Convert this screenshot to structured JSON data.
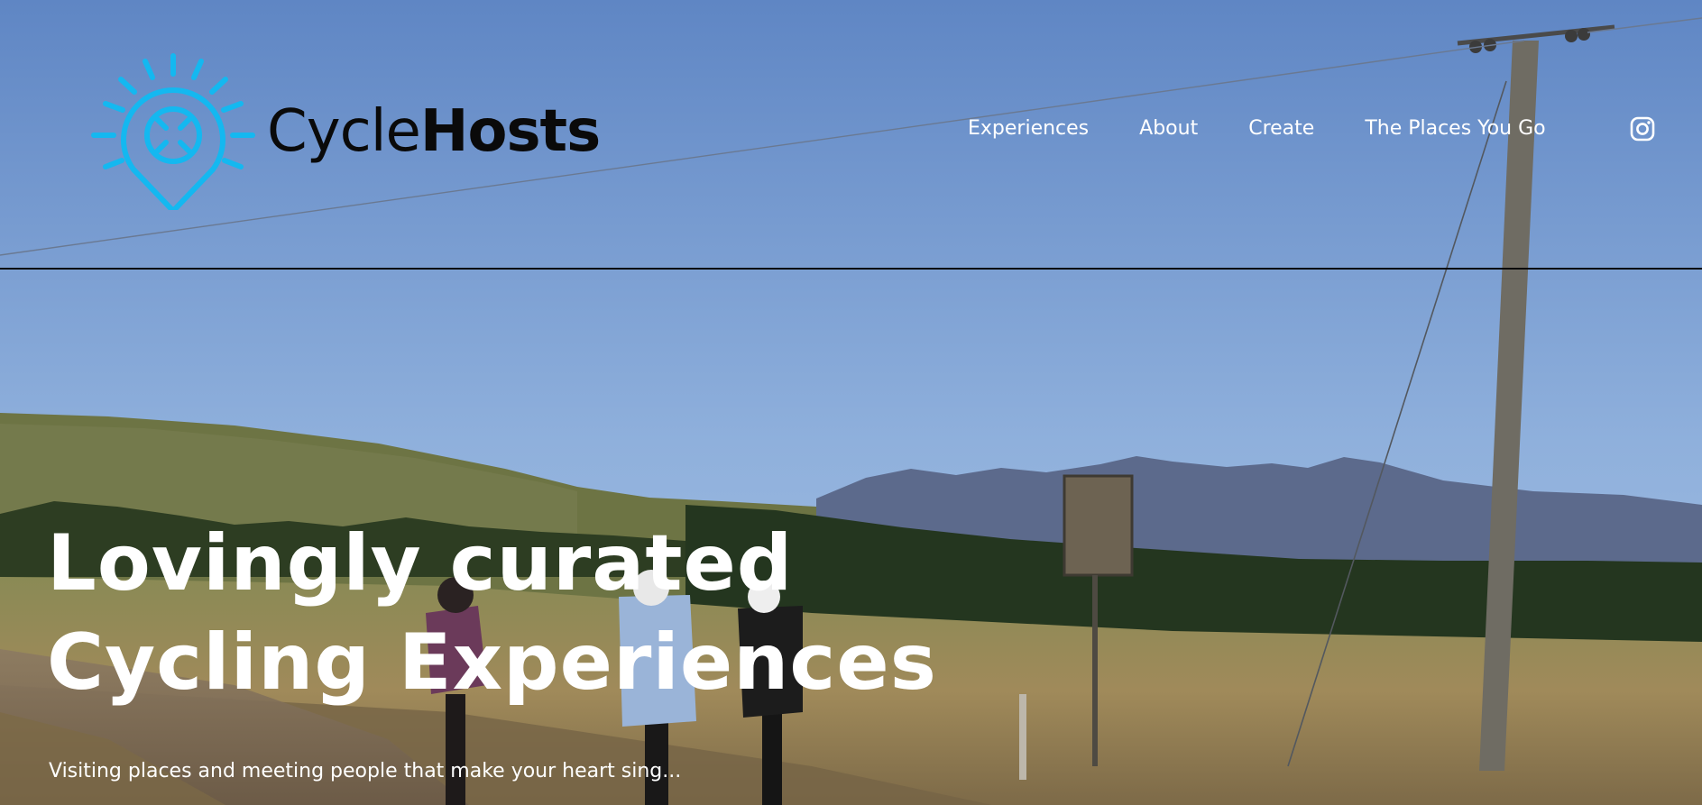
{
  "brand": {
    "name_light": "Cycle",
    "name_bold": "Hosts",
    "accent_color": "#14b8f0",
    "logo_icon": "map-pin-sun-icon"
  },
  "nav": {
    "items": [
      {
        "label": "Experiences"
      },
      {
        "label": "About"
      },
      {
        "label": "Create"
      },
      {
        "label": "The Places You Go"
      }
    ],
    "social_icon": "instagram-icon"
  },
  "hero": {
    "headline_line1": "Lovingly curated",
    "headline_line2": "Cycling Experiences",
    "tagline": "Visiting places and meeting people that make your heart sing...",
    "image": "cyclists-riding-gravel-road-with-mountains-and-power-pole"
  }
}
